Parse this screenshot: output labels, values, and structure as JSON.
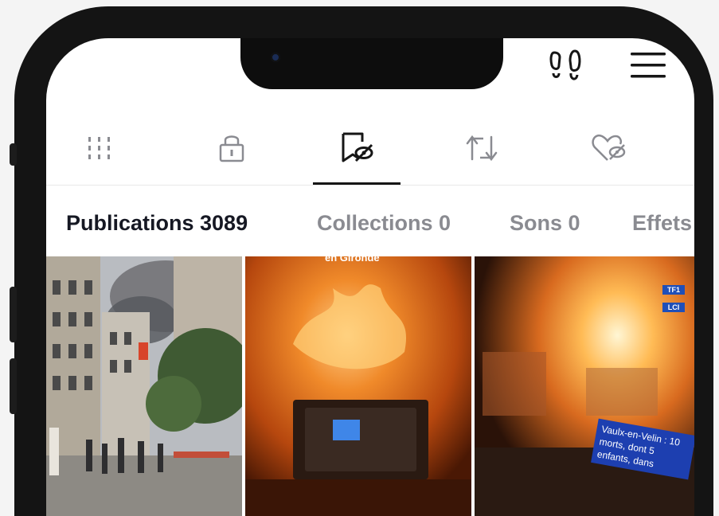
{
  "header": {
    "icons": [
      "footprints-icon",
      "hamburger-menu-icon"
    ]
  },
  "profile_tabs": [
    {
      "icon": "grid-icon",
      "active": false
    },
    {
      "icon": "lock-icon",
      "active": false
    },
    {
      "icon": "bookmark-hidden-icon",
      "active": true
    },
    {
      "icon": "repost-icon",
      "active": false
    },
    {
      "icon": "heart-hidden-icon",
      "active": false
    }
  ],
  "subtabs": [
    {
      "label": "Publications 3089",
      "active": true
    },
    {
      "label": "Collections 0",
      "active": false
    },
    {
      "label": "Sons 0",
      "active": false
    },
    {
      "label": "Effets",
      "active": false
    }
  ],
  "thumbnails": [
    {
      "caption": ""
    },
    {
      "caption": "en Gironde"
    },
    {
      "caption": "Vaulx-en-Velin : 10 morts, dont 5 enfants, dans",
      "channel_logos": [
        "TF1",
        "LCI"
      ]
    }
  ],
  "colors": {
    "text_active": "#161823",
    "text_inactive": "#8a8b91",
    "icon_gray": "#8a8b91",
    "frame": "#141414"
  }
}
